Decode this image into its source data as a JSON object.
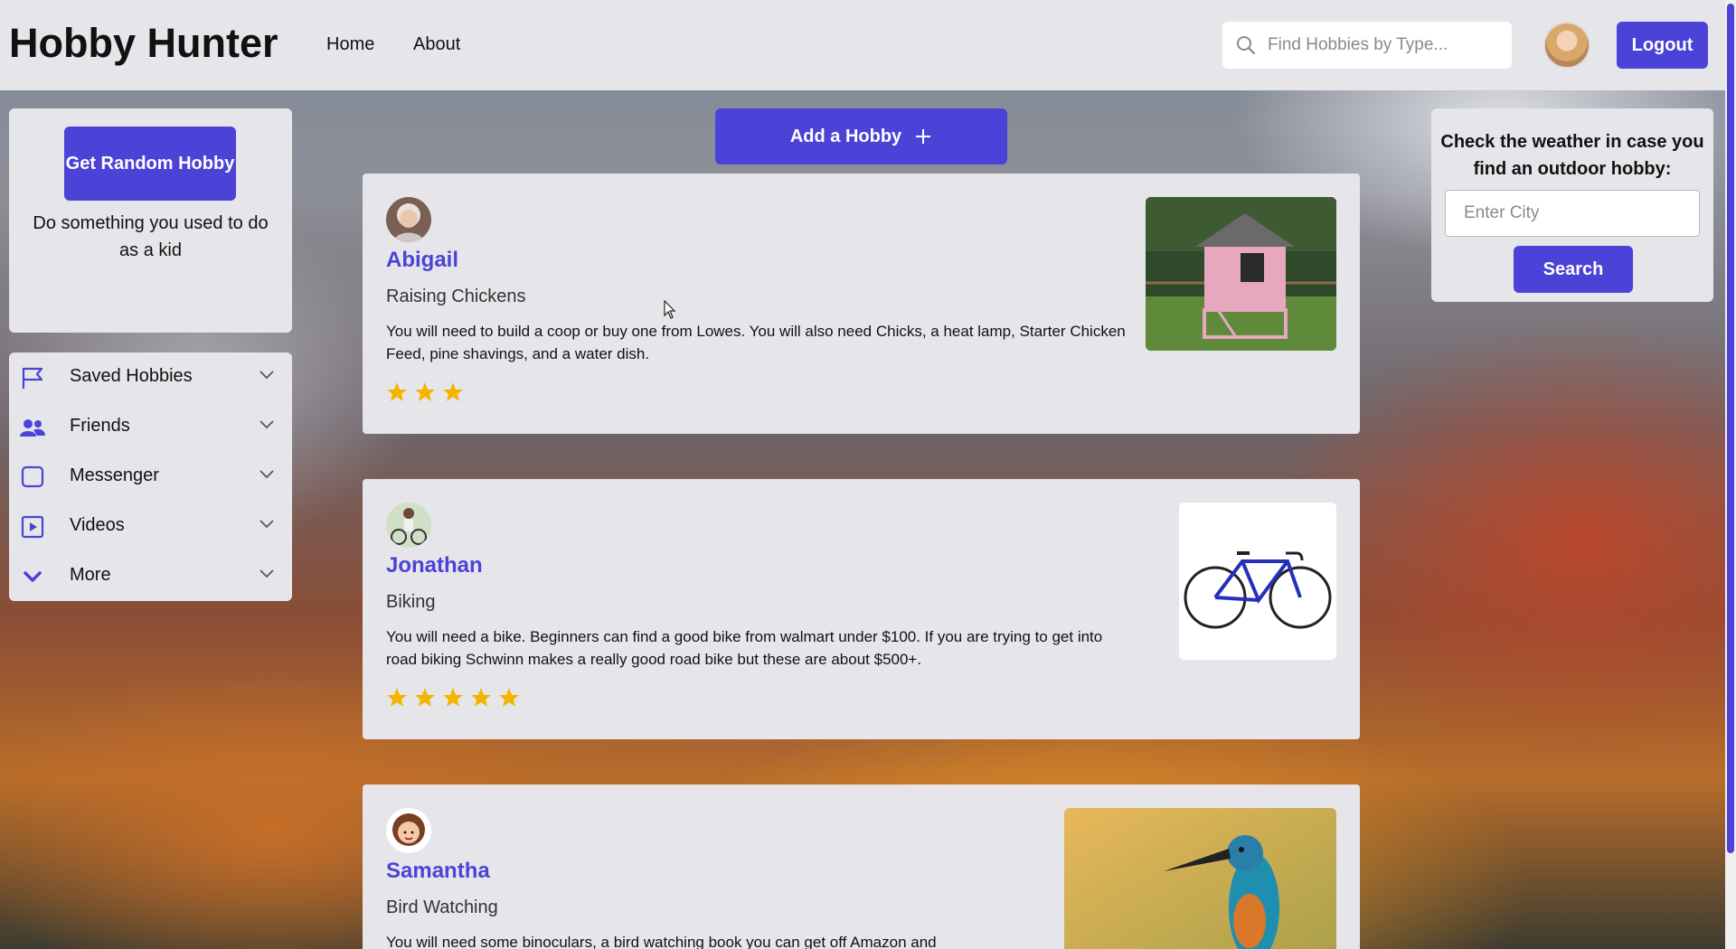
{
  "app": {
    "brand": "Hobby Hunter",
    "nav": [
      "Home",
      "About"
    ],
    "search_placeholder": "Find Hobbies by Type...",
    "logout_label": "Logout",
    "accent_color": "#4b43d8"
  },
  "random": {
    "button_label": "Get Random Hobby",
    "suggestion": "Do something you used to do as a kid"
  },
  "menu": {
    "items": [
      {
        "label": "Saved Hobbies",
        "icon": "flag-icon"
      },
      {
        "label": "Friends",
        "icon": "users-icon"
      },
      {
        "label": "Messenger",
        "icon": "message-icon"
      },
      {
        "label": "Videos",
        "icon": "video-icon"
      },
      {
        "label": "More",
        "icon": "chevron-down-icon"
      }
    ]
  },
  "add_hobby_label": "Add a Hobby",
  "posts": [
    {
      "name": "Abigail",
      "hobby": "Raising Chickens",
      "description": "You will need to build a coop or buy one from Lowes. You will also need Chicks, a heat lamp, Starter Chicken Feed, pine shavings, and a water dish.",
      "rating": 3
    },
    {
      "name": "Jonathan",
      "hobby": "Biking",
      "description": "You will need a bike. Beginners can find a good bike from walmart under $100. If you are trying to get into road biking Schwinn makes a really good road bike but these are about $500+.",
      "rating": 5
    },
    {
      "name": "Samantha",
      "hobby": "Bird Watching",
      "description": "You will need some binoculars, a bird watching book you can get off Amazon and"
    }
  ],
  "weather": {
    "title": "Check the weather in case you find an outdoor hobby:",
    "input_placeholder": "Enter City",
    "button_label": "Search"
  }
}
